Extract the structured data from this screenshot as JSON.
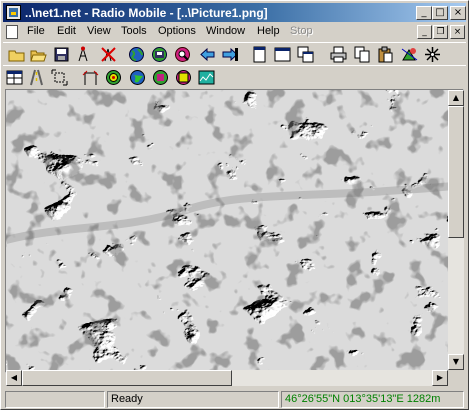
{
  "window": {
    "title": "..\\net1.net - Radio Mobile - [..\\Picture1.png]"
  },
  "title_buttons": {
    "minimize": "_",
    "maximize": "□",
    "close": "×"
  },
  "menu": {
    "items": [
      "File",
      "Edit",
      "View",
      "Tools",
      "Options",
      "Window",
      "Help",
      "Stop"
    ],
    "disabled": [
      "Stop"
    ],
    "mdi": {
      "minimize": "_",
      "restore": "❐",
      "close": "×"
    }
  },
  "toolbar_row1": [
    "new-map-icon",
    "open-folder-icon",
    "save-icon",
    "network-properties-icon",
    "tower-edit-icon",
    "world-globe-icon",
    "map-extract-icon",
    "find-icon",
    "back-arrow-icon",
    "forward-arrow-icon",
    "copy-window-icon",
    "window-icon",
    "window-stack-icon",
    "print-icon",
    "copy-icon",
    "paste-icon",
    "merge-pictures-icon",
    "hide-network-icon"
  ],
  "toolbar_row2": [
    "style-grid-icon",
    "road-icon",
    "resize-icon",
    "radio-link-icon",
    "polar-plot-icon",
    "coverage-map-icon",
    "cartesian-plot-icon",
    "globe-overlay-icon",
    "chart-icon"
  ],
  "colors": {
    "titlebar_start": "#0a246a",
    "titlebar_end": "#a6caf0",
    "coords_text": "#008000",
    "face": "#d4d0c8"
  },
  "status": {
    "panel1": "",
    "message": "Ready",
    "coordinates": "46°26'55\"N 013°35'13\"E 1282m"
  }
}
